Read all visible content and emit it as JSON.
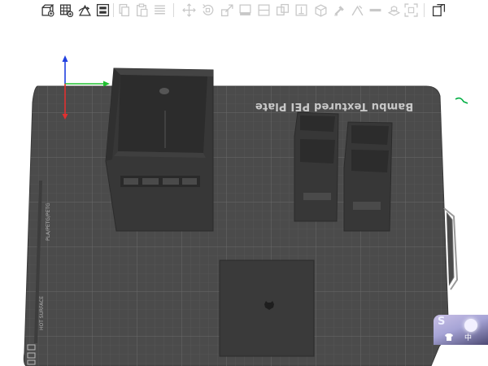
{
  "toolbar": {
    "buttons": [
      {
        "name": "add-object-icon",
        "enabled": true
      },
      {
        "name": "add-plate-icon",
        "enabled": true
      },
      {
        "name": "auto-orient-icon",
        "enabled": true
      },
      {
        "name": "arrange-icon",
        "enabled": true
      },
      {
        "name": "copy-icon",
        "enabled": false
      },
      {
        "name": "paste-icon",
        "enabled": false
      },
      {
        "name": "split-layers-icon",
        "enabled": false
      },
      {
        "name": "move-icon",
        "enabled": false
      },
      {
        "name": "rotate-icon",
        "enabled": false
      },
      {
        "name": "scale-icon",
        "enabled": false
      },
      {
        "name": "lay-on-face-icon",
        "enabled": false
      },
      {
        "name": "cut-icon",
        "enabled": false
      },
      {
        "name": "boolean-icon",
        "enabled": false
      },
      {
        "name": "support-paint-icon",
        "enabled": false
      },
      {
        "name": "seam-paint-icon",
        "enabled": false
      },
      {
        "name": "color-paint-icon",
        "enabled": false
      },
      {
        "name": "measure-icon",
        "enabled": false
      },
      {
        "name": "text-emboss-icon",
        "enabled": false
      },
      {
        "name": "fit-view-icon",
        "enabled": false
      },
      {
        "name": "assembly-view-icon",
        "enabled": true
      }
    ]
  },
  "plate": {
    "label": "Bambu Textured PEI Plate",
    "side_label_1": "PLA/PETG/PETG",
    "side_label_2": "HOT\nSURFACE"
  },
  "avatar": {
    "initial": "S",
    "language": "中"
  },
  "colors": {
    "plate": "#4a4a4a",
    "grid": "#5a5a5a",
    "object": "#3a3a3a",
    "object_edge": "#2a2a2a",
    "axis_x": "#e03030",
    "axis_y": "#20c030",
    "axis_z": "#2040e0",
    "accent": "#00ae42"
  }
}
